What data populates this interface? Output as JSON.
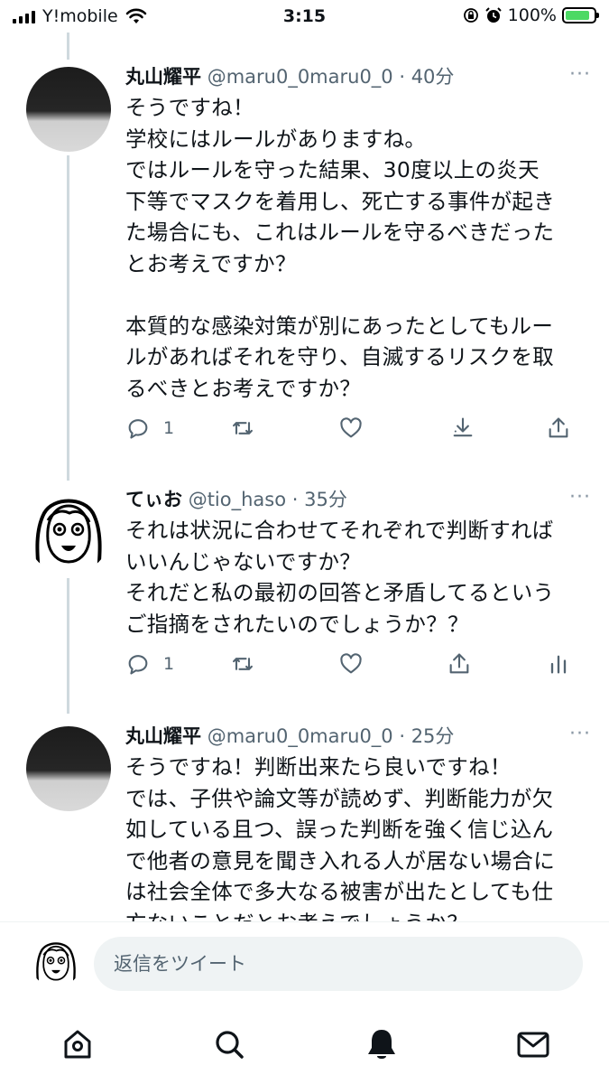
{
  "status_bar": {
    "carrier": "Y!mobile",
    "time": "3:15",
    "battery": "100%"
  },
  "tweets": [
    {
      "name": "丸山耀平",
      "meta": "@maru0_0maru0_0 · 40分",
      "text": "そうですね！\n学校にはルールがありますね。\nではルールを守った結果、30度以上の炎天\n下等でマスクを着用し、死亡する事件が起き\nた場合にも、これはルールを守るべきだった\nとお考えですか？\n\n本質的な感染対策が別にあったとしてもルー\nルがあればそれを守り、自滅するリスクを取\nるべきとお考えですか？",
      "reply_count": "1",
      "avatar": "photo"
    },
    {
      "name": "てぃお",
      "meta": "@tio_haso · 35分",
      "text": "それは状況に合わせてそれぞれで判断すれば\nいいんじゃないですか？\nそれだと私の最初の回答と矛盾してるという\nご指摘をされたいのでしょうか？？",
      "reply_count": "1",
      "avatar": "drawn-face"
    },
    {
      "name": "丸山耀平",
      "meta": "@maru0_0maru0_0 · 25分",
      "text": "そうですね！判断出来たら良いですね！\nでは、子供や論文等が読めず、判断能力が欠\n如している且つ、誤った判断を強く信じ込ん\nで他者の意見を聞き入れる人が居ない場合に\nは社会全体で多大なる被害が出たとしても仕\n方ないことだとお考えでしょうか？",
      "avatar": "photo"
    }
  ],
  "more_icon": "···",
  "reply_bar": {
    "placeholder": "返信をツイート"
  },
  "tab_bar": {
    "icons": [
      "home-icon",
      "search-icon",
      "notifications-icon",
      "messages-icon"
    ]
  },
  "colors": {
    "text": "#0f1419",
    "secondary": "#536471",
    "thread_line": "#cfd9de",
    "battery_green": "#4cd964",
    "input_bg": "#eff3f4"
  }
}
